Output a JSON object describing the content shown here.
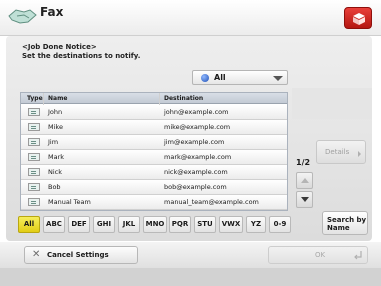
{
  "header": {
    "title": "Fax",
    "app_icon": "fax-handshake-icon",
    "status_icon": "status-monitor-icon"
  },
  "notice": {
    "line1": "<Job Done Notice>",
    "line2": "Set the destinations to notify."
  },
  "filter": {
    "selected": "All"
  },
  "table": {
    "columns": [
      "Type",
      "Name",
      "Destination"
    ],
    "rows": [
      {
        "name": "John",
        "destination": "john@example.com"
      },
      {
        "name": "Mike",
        "destination": "mike@example.com"
      },
      {
        "name": "Jim",
        "destination": "jim@example.com"
      },
      {
        "name": "Mark",
        "destination": "mark@example.com"
      },
      {
        "name": "Nick",
        "destination": "nick@example.com"
      },
      {
        "name": "Bob",
        "destination": "bob@example.com"
      },
      {
        "name": "Manual Team",
        "destination": "manual_team@example.com"
      }
    ]
  },
  "details_label": "Details",
  "page_indicator": "1/2",
  "tabs": [
    "All",
    "ABC",
    "DEF",
    "GHI",
    "JKL",
    "MNO",
    "PQR",
    "STU",
    "VWX",
    "YZ",
    "0-9"
  ],
  "search_by_name": {
    "line1": "Search by",
    "line2": "Name"
  },
  "cancel_label": "Cancel Settings",
  "ok_label": "OK"
}
